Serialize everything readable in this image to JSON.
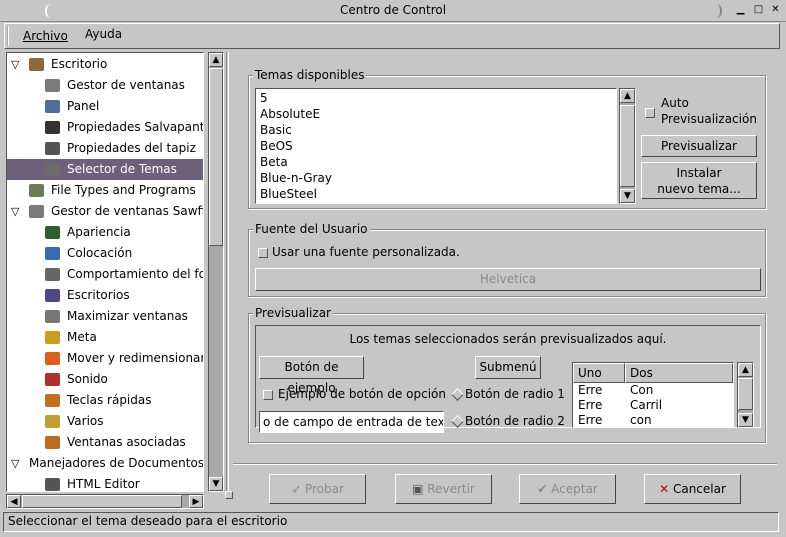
{
  "window": {
    "title": "Centro de Control",
    "minimize": "▁",
    "maximize": "□",
    "close": "✕"
  },
  "menu": {
    "file": "Archivo",
    "help": "Ayuda"
  },
  "tree": [
    {
      "label": "Escritorio",
      "level": 0,
      "expander": "open",
      "icon": "desktop-icon"
    },
    {
      "label": "Gestor de ventanas",
      "level": 1,
      "icon": "window-manager-icon"
    },
    {
      "label": "Panel",
      "level": 1,
      "icon": "panel-icon"
    },
    {
      "label": "Propiedades Salvapanta",
      "level": 1,
      "icon": "screensaver-icon"
    },
    {
      "label": "Propiedades del tapiz",
      "level": 1,
      "icon": "wallpaper-icon"
    },
    {
      "label": "Selector de Temas",
      "level": 1,
      "icon": "theme-selector-icon",
      "selected": true
    },
    {
      "label": "File Types and Programs",
      "level": 0,
      "icon": "file-types-icon"
    },
    {
      "label": "Gestor de ventanas Sawfish",
      "level": 0,
      "expander": "open",
      "icon": "sawfish-icon"
    },
    {
      "label": "Apariencia",
      "level": 1,
      "icon": "appearance-icon"
    },
    {
      "label": "Colocación",
      "level": 1,
      "icon": "placement-icon"
    },
    {
      "label": "Comportamiento del foco",
      "level": 1,
      "icon": "focus-icon"
    },
    {
      "label": "Escritorios",
      "level": 1,
      "icon": "workspaces-icon"
    },
    {
      "label": "Maximizar ventanas",
      "level": 1,
      "icon": "maximize-icon"
    },
    {
      "label": "Meta",
      "level": 1,
      "icon": "meta-icon"
    },
    {
      "label": "Mover y redimensionar",
      "level": 1,
      "icon": "move-resize-icon"
    },
    {
      "label": "Sonido",
      "level": 1,
      "icon": "sound-icon"
    },
    {
      "label": "Teclas rápidas",
      "level": 1,
      "icon": "shortcuts-icon"
    },
    {
      "label": "Varios",
      "level": 1,
      "icon": "misc-icon"
    },
    {
      "label": "Ventanas asociadas",
      "level": 1,
      "icon": "matched-windows-icon"
    },
    {
      "label": "Manejadores de Documentos",
      "level": 0,
      "expander": "open",
      "icon": ""
    },
    {
      "label": "HTML Editor",
      "level": 1,
      "icon": "html-editor-icon"
    }
  ],
  "themes": {
    "group_label": "Temas disponibles",
    "items": [
      "5",
      "AbsoluteE",
      "Basic",
      "BeOS",
      "Beta",
      "Blue-n-Gray",
      "BlueSteel"
    ],
    "auto_preview_label": "Auto\nPrevisualización",
    "preview_button": "Previsualizar",
    "install_button": "Instalar\nnuevo tema..."
  },
  "font": {
    "group_label": "Fuente del Usuario",
    "custom_font_label": "Usar una fuente personalizada.",
    "font_button": "Helvetica"
  },
  "preview": {
    "group_label": "Previsualizar",
    "message": "Los temas seleccionados serán previsualizados aquí.",
    "example_button": "Botón de ejemplo",
    "submenu_button": "Submenú",
    "option_button": "Ejemplo de botón de opción",
    "radio1": "Botón de radio 1",
    "radio2": "Botón de radio 2",
    "entry_value": "o de campo de entrada de texto",
    "list_headers": [
      "Uno",
      "Dos"
    ],
    "list_rows": [
      [
        "Erre",
        "Con"
      ],
      [
        "Erre",
        "Carril"
      ],
      [
        "Erre",
        "con"
      ]
    ]
  },
  "actions": {
    "try": "Probar",
    "revert": "Revertir",
    "ok": "Aceptar",
    "cancel": "Cancelar"
  },
  "status": {
    "text": "Seleccionar el tema deseado para el escritorio"
  }
}
